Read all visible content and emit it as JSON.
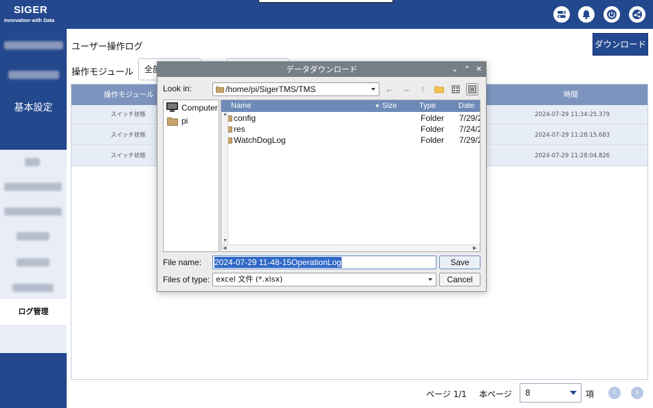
{
  "app": {
    "brand_name": "SIGER",
    "brand_tagline": "Innovation with Data"
  },
  "header_icons": [
    "settings-toggle-icon",
    "bell-icon",
    "power-icon",
    "share-icon"
  ],
  "sidebar": {
    "basic_settings": "基本設定",
    "log_management": "ログ管理"
  },
  "main": {
    "title": "ユーザー操作ログ",
    "download_label": "ダウンロード",
    "filter_label": "操作モジュール",
    "filter_value": "全部"
  },
  "table": {
    "headers": {
      "module": "操作モジュール",
      "time": "時間"
    },
    "rows": [
      {
        "module": "スイッチ状態",
        "time": "2024-07-29 11:34:25.379"
      },
      {
        "module": "スイッチ状態",
        "time": "2024-07-29 11:28:15.683"
      },
      {
        "module": "スイッチ状態",
        "time": "2024-07-29 11:28:04.826"
      }
    ]
  },
  "pagination": {
    "page_text": "ページ 1/1",
    "per_page_label": "本ページ",
    "per_page_value": "8",
    "unit": "項",
    "prev_icon": "chevron-left-icon",
    "next_icon": "chevron-right-icon"
  },
  "dialog": {
    "title": "データダウンロード",
    "look_in_label": "Look in:",
    "path": "/home/pi/SigerTMS/TMS",
    "places": [
      {
        "label": "Computer",
        "icon": "computer-icon"
      },
      {
        "label": "pi",
        "icon": "folder-icon"
      }
    ],
    "columns": {
      "name": "Name",
      "size": "Size",
      "type": "Type",
      "date": "Date M"
    },
    "files": [
      {
        "name": "config",
        "type": "Folder",
        "date": "7/29/2"
      },
      {
        "name": "res",
        "type": "Folder",
        "date": "7/24/2"
      },
      {
        "name": "WatchDogLog",
        "type": "Folder",
        "date": "7/29/2"
      }
    ],
    "file_name_label": "File name:",
    "file_name_value": "2024-07-29 11-48-15OperationLog",
    "save_label": "Save",
    "file_type_label": "Files of type:",
    "file_type_value": "excel 文件 (*.xlsx)",
    "cancel_label": "Cancel"
  }
}
